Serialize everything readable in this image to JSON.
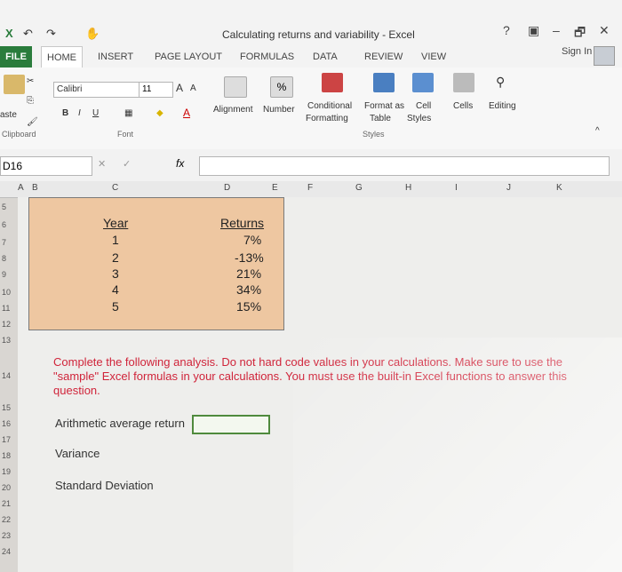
{
  "window": {
    "title": "Calculating returns and variability - Excel",
    "help": "?",
    "controls": {
      "minimize": "–",
      "restore": "🗗",
      "close": "✕"
    },
    "sign_in": "Sign In"
  },
  "tabs": [
    "FILE",
    "HOME",
    "INSERT",
    "PAGE LAYOUT",
    "FORMULAS",
    "DATA",
    "REVIEW",
    "VIEW"
  ],
  "ribbon": {
    "clipboard": {
      "paste": "aste",
      "label": "Clipboard"
    },
    "font": {
      "name": "Calibri",
      "size": "11",
      "bold": "B",
      "italic": "I",
      "underline": "U",
      "grow": "A",
      "shrink": "A",
      "label": "Font"
    },
    "alignment": "Alignment",
    "number": "Number",
    "styles": {
      "conditional": "Conditional",
      "formatting": "Formatting",
      "format_as": "Format as",
      "table": "Table",
      "cell": "Cell",
      "cell_styles": "Styles",
      "label": "Styles"
    },
    "cells": "Cells",
    "editing": "Editing"
  },
  "formula_bar": {
    "name_box": "D16",
    "fx": "fx"
  },
  "columns": [
    "A",
    "B",
    "C",
    "D",
    "E",
    "F",
    "G",
    "H",
    "I",
    "J",
    "K"
  ],
  "rows": [
    "5",
    "6",
    "7",
    "8",
    "9",
    "10",
    "11",
    "12",
    "13",
    "14",
    "15",
    "16",
    "17",
    "18",
    "19",
    "20",
    "21",
    "22",
    "23",
    "24"
  ],
  "table": {
    "year_header": "Year",
    "returns_header": "Returns",
    "years": [
      "1",
      "2",
      "3",
      "4",
      "5"
    ],
    "returns": [
      "7%",
      "-13%",
      "21%",
      "34%",
      "15%"
    ]
  },
  "instructions": "Complete the following analysis. Do not hard code values in your calculations. Make sure to use the \"sample\" Excel formulas in your calculations. You must use the built-in Excel functions to answer this question.",
  "labels": {
    "arithmetic": "Arithmetic average return",
    "variance": "Variance",
    "std": "Standard Deviation"
  }
}
